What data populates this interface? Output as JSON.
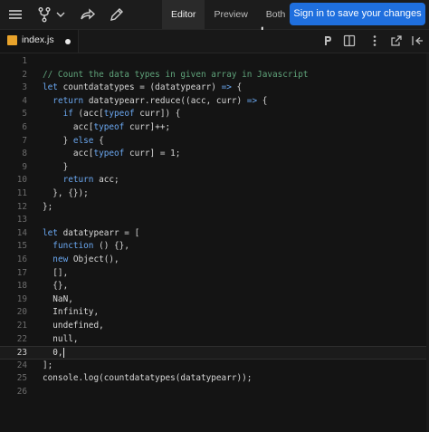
{
  "toolbar": {
    "tabs": [
      {
        "label": "Editor",
        "active": true
      },
      {
        "label": "Preview",
        "active": false
      },
      {
        "label": "Both",
        "active": false
      }
    ],
    "signin_label": "Sign in to save your changes"
  },
  "file_tab": {
    "name": "index.js"
  },
  "editor": {
    "current_line": 23,
    "lines": [
      {
        "n": "1",
        "text": ""
      },
      {
        "n": "2",
        "text": "// Count the data types in given array in Javascript"
      },
      {
        "n": "3",
        "text": "let countdatatypes = (datatypearr) => {"
      },
      {
        "n": "4",
        "text": "  return datatypearr.reduce((acc, curr) => {"
      },
      {
        "n": "5",
        "text": "    if (acc[typeof curr]) {"
      },
      {
        "n": "6",
        "text": "      acc[typeof curr]++;"
      },
      {
        "n": "7",
        "text": "    } else {"
      },
      {
        "n": "8",
        "text": "      acc[typeof curr] = 1;"
      },
      {
        "n": "9",
        "text": "    }"
      },
      {
        "n": "10",
        "text": "    return acc;"
      },
      {
        "n": "11",
        "text": "  }, {});"
      },
      {
        "n": "12",
        "text": "};"
      },
      {
        "n": "13",
        "text": ""
      },
      {
        "n": "14",
        "text": "let datatypearr = ["
      },
      {
        "n": "15",
        "text": "  function () {},"
      },
      {
        "n": "16",
        "text": "  new Object(),"
      },
      {
        "n": "17",
        "text": "  [],"
      },
      {
        "n": "18",
        "text": "  {},"
      },
      {
        "n": "19",
        "text": "  NaN,"
      },
      {
        "n": "20",
        "text": "  Infinity,"
      },
      {
        "n": "21",
        "text": "  undefined,"
      },
      {
        "n": "22",
        "text": "  null,"
      },
      {
        "n": "23",
        "text": "  0,"
      },
      {
        "n": "24",
        "text": "];"
      },
      {
        "n": "25",
        "text": "console.log(countdatatypes(datatypearr));"
      },
      {
        "n": "26",
        "text": ""
      }
    ]
  }
}
